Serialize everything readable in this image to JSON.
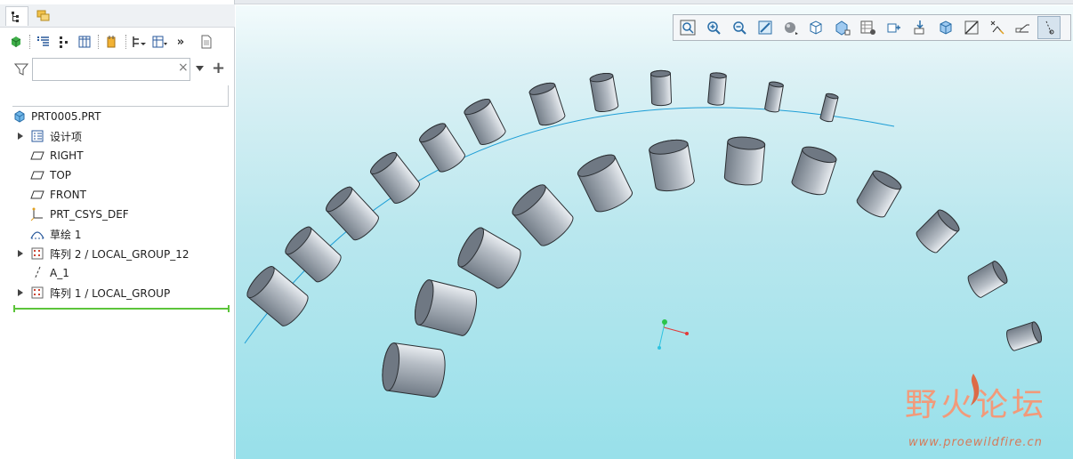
{
  "panel_tabs": [
    {
      "name": "model-tree-tab",
      "icon": "tree-icon"
    },
    {
      "name": "layers-tab",
      "icon": "layers-icon"
    }
  ],
  "tree_toolbar": {
    "icons": [
      "green-cube-icon",
      "tree-list-icon",
      "tree-filter-icon",
      "column-icon",
      "highlight-icon",
      "show-dropdown-icon",
      "settings-dropdown-icon",
      "more-icon",
      "info-icon"
    ]
  },
  "filter": {
    "value": "",
    "placeholder": ""
  },
  "model_tree": {
    "root": "PRT0005.PRT",
    "items": [
      {
        "label": "设计项",
        "icon": "design-items-icon",
        "expandable": true
      },
      {
        "label": "RIGHT",
        "icon": "datum-plane-icon",
        "expandable": false
      },
      {
        "label": "TOP",
        "icon": "datum-plane-icon",
        "expandable": false
      },
      {
        "label": "FRONT",
        "icon": "datum-plane-icon",
        "expandable": false
      },
      {
        "label": "PRT_CSYS_DEF",
        "icon": "csys-icon",
        "expandable": false
      },
      {
        "label": "草绘 1",
        "icon": "sketch-icon",
        "expandable": false
      },
      {
        "label": "阵列 2 / LOCAL_GROUP_12",
        "icon": "pattern-icon",
        "expandable": true
      },
      {
        "label": "A_1",
        "icon": "axis-icon",
        "expandable": false
      },
      {
        "label": "阵列 1 / LOCAL_GROUP",
        "icon": "pattern-icon",
        "expandable": true
      }
    ]
  },
  "view_toolbar": {
    "buttons": [
      "refit-icon",
      "zoom-in-icon",
      "zoom-out-icon",
      "repaint-icon",
      "shading-icon",
      "display-style-icon",
      "saved-views-icon",
      "view-manager-icon",
      "perspective-icon",
      "spin-center-icon",
      "plane-display-icon",
      "axis-display-icon",
      "point-display-icon",
      "csys-display-icon",
      "annotation-display-icon"
    ]
  },
  "watermark": {
    "title": "野火论坛",
    "url": "www.proewildfire.cn"
  },
  "colors": {
    "viewport_top": "#f3fbfc",
    "viewport_bottom": "#98e0ea",
    "cylinder_fill": "#9aa3ad",
    "curve": "#1d9ed6",
    "insert_line": "#5cc43a"
  }
}
